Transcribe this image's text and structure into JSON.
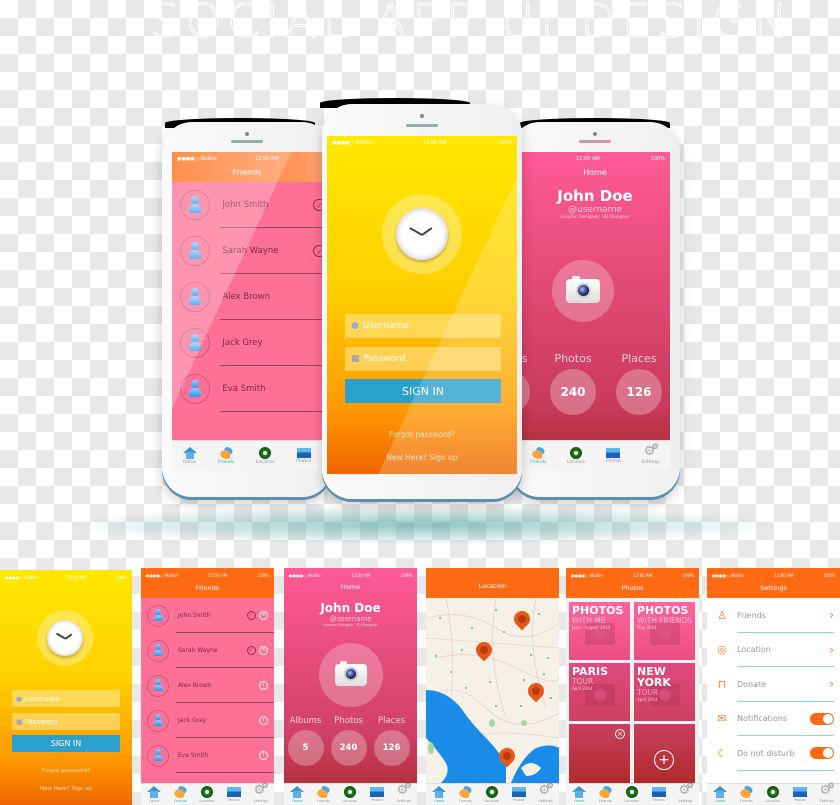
{
  "title": "SOCIAL APP UI DESIGN",
  "status_bar": {
    "carrier": "●●●●○ Mobile",
    "wifi": "wifi-icon",
    "time": "12:00 AM",
    "battery": "100%"
  },
  "colors": {
    "orange": "#ff6a13",
    "yellow": "#ffe600",
    "pink": "#ff6f93",
    "blue_button": "#2ba0cf",
    "active_tab": "#27b8a8"
  },
  "tabbar": {
    "tabs": [
      {
        "label": "Home",
        "icon": "home-icon"
      },
      {
        "label": "Friends",
        "icon": "friends-icon"
      },
      {
        "label": "Location",
        "icon": "location-icon"
      },
      {
        "label": "Photos",
        "icon": "photos-icon"
      },
      {
        "label": "Settings",
        "icon": "settings-icon"
      }
    ]
  },
  "login": {
    "username_placeholder": "Username",
    "password_placeholder": "Password",
    "sign_in": "SIGN IN",
    "forgot": "Forgot password?",
    "signup": "New Here? Sign up"
  },
  "friends": {
    "header": "Friends",
    "items": [
      {
        "name": "John Smith",
        "status": "request"
      },
      {
        "name": "Sarah Wayne",
        "status": "request"
      },
      {
        "name": "Alex Brown",
        "status": "info"
      },
      {
        "name": "Jack Grey",
        "status": "info"
      },
      {
        "name": "Eva Smith",
        "status": "info"
      }
    ]
  },
  "profile": {
    "header": "Home",
    "name": "John Doe",
    "username": "@username",
    "role": "Graphic Designer, 3D Designer",
    "stats": [
      {
        "label": "Albums",
        "value": "5"
      },
      {
        "label": "Photos",
        "value": "240"
      },
      {
        "label": "Places",
        "value": "126"
      }
    ]
  },
  "location": {
    "header": "Location"
  },
  "photos": {
    "header": "Photos",
    "albums": [
      {
        "title": "PHOTOS",
        "subtitle": "WITH ME",
        "date": "June - August 2014"
      },
      {
        "title": "PHOTOS",
        "subtitle": "WITH FRIENDS",
        "date": "May 2014"
      },
      {
        "title": "PARIS",
        "subtitle": "TOUR",
        "date": "April 2014"
      },
      {
        "title": "NEW YORK",
        "subtitle": "TOUR",
        "date": "April 2014"
      }
    ]
  },
  "settings": {
    "header": "Settings",
    "items": [
      {
        "label": "Friends",
        "icon": "person-outline-icon",
        "control": "chevron"
      },
      {
        "label": "Location",
        "icon": "map-pin-outline-icon",
        "control": "chevron"
      },
      {
        "label": "Donate",
        "icon": "shopping-bag-icon",
        "control": "chevron"
      },
      {
        "label": "Notifications",
        "icon": "envelope-icon",
        "control": "toggle",
        "on": true
      },
      {
        "label": "Do not disturb",
        "icon": "moon-icon",
        "control": "toggle",
        "on": true
      }
    ]
  }
}
